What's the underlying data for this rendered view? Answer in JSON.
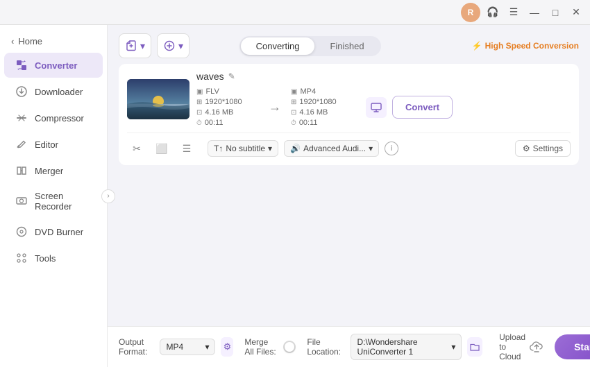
{
  "titlebar": {
    "user_initial": "R",
    "btn_minimize": "—",
    "btn_maximize": "□",
    "btn_close": "✕"
  },
  "sidebar": {
    "back_label": "Home",
    "items": [
      {
        "id": "converter",
        "label": "Converter",
        "active": true
      },
      {
        "id": "downloader",
        "label": "Downloader",
        "active": false
      },
      {
        "id": "compressor",
        "label": "Compressor",
        "active": false
      },
      {
        "id": "editor",
        "label": "Editor",
        "active": false
      },
      {
        "id": "merger",
        "label": "Merger",
        "active": false
      },
      {
        "id": "screen-recorder",
        "label": "Screen Recorder",
        "active": false
      },
      {
        "id": "dvd-burner",
        "label": "DVD Burner",
        "active": false
      },
      {
        "id": "tools",
        "label": "Tools",
        "active": false
      }
    ]
  },
  "toolbar": {
    "tab_converting": "Converting",
    "tab_finished": "Finished",
    "speed_label": "High Speed Conversion"
  },
  "file": {
    "name": "waves",
    "source": {
      "format": "FLV",
      "resolution": "1920*1080",
      "size": "4.16 MB",
      "duration": "00:11"
    },
    "target": {
      "format": "MP4",
      "resolution": "1920*1080",
      "size": "4.16 MB",
      "duration": "00:11"
    },
    "convert_btn": "Convert",
    "subtitle": "No subtitle",
    "audio": "Advanced Audi...",
    "settings": "Settings"
  },
  "bottom": {
    "output_format_label": "Output Format:",
    "output_format_value": "MP4",
    "file_location_label": "File Location:",
    "file_location_value": "D:\\Wondershare UniConverter 1",
    "merge_label": "Merge All Files:",
    "upload_label": "Upload to Cloud",
    "start_all": "Start All"
  }
}
